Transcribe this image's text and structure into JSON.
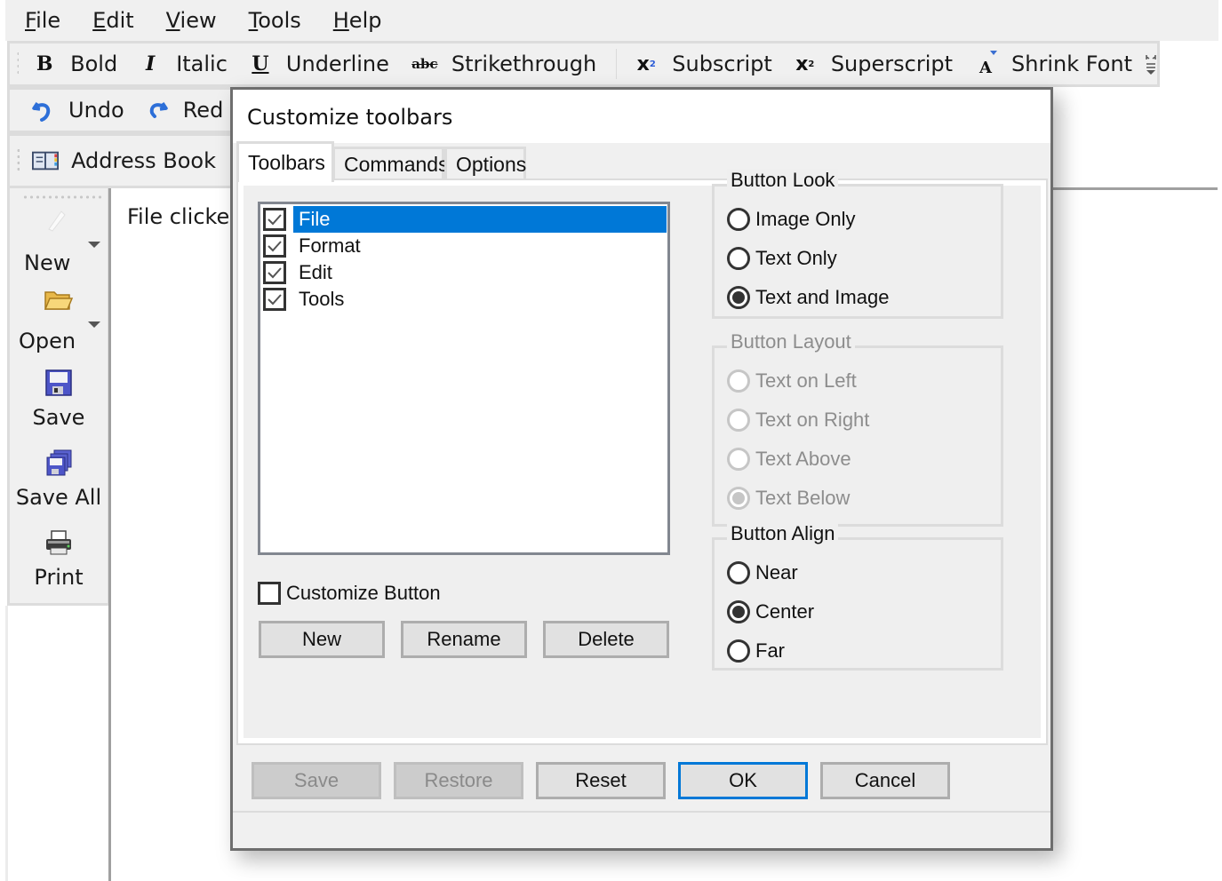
{
  "menubar": {
    "items": [
      {
        "label": "File",
        "mnemonic": "F",
        "rest": "ile"
      },
      {
        "label": "Edit",
        "mnemonic": "E",
        "rest": "dit"
      },
      {
        "label": "View",
        "mnemonic": "V",
        "rest": "iew"
      },
      {
        "label": "Tools",
        "mnemonic": "T",
        "rest": "ools"
      },
      {
        "label": "Help",
        "mnemonic": "H",
        "rest": "elp"
      }
    ]
  },
  "format_toolbar": {
    "buttons": [
      {
        "icon": "bold-icon",
        "glyph": "B",
        "label": "Bold"
      },
      {
        "icon": "italic-icon",
        "glyph": "I",
        "label": "Italic"
      },
      {
        "icon": "underline-icon",
        "glyph": "U",
        "label": "Underline"
      },
      {
        "icon": "strikethrough-icon",
        "glyph": "abc",
        "label": "Strikethrough"
      },
      {
        "icon": "subscript-icon",
        "glyph": "x",
        "label": "Subscript"
      },
      {
        "icon": "superscript-icon",
        "glyph": "x",
        "label": "Superscript"
      },
      {
        "icon": "shrink-font-icon",
        "glyph": "A",
        "label": "Shrink Font"
      }
    ]
  },
  "edit_toolbar": {
    "buttons": [
      {
        "icon": "undo-icon",
        "label": "Undo"
      },
      {
        "icon": "redo-icon",
        "label": "Red"
      }
    ]
  },
  "tools_toolbar": {
    "buttons": [
      {
        "icon": "address-book-icon",
        "label": "Address Book"
      }
    ]
  },
  "file_toolbar": {
    "buttons": [
      {
        "icon": "new-icon",
        "label": "New",
        "dropdown": true
      },
      {
        "icon": "open-folder-icon",
        "label": "Open",
        "dropdown": true
      },
      {
        "icon": "save-icon",
        "label": "Save"
      },
      {
        "icon": "save-all-icon",
        "label": "Save All"
      },
      {
        "icon": "print-icon",
        "label": "Print"
      }
    ]
  },
  "content": {
    "status_text": "File clicked"
  },
  "dialog": {
    "title": "Customize toolbars",
    "tabs": [
      {
        "label": "Toolbars",
        "active": true
      },
      {
        "label": "Commands",
        "active": false
      },
      {
        "label": "Options",
        "active": false
      }
    ],
    "toolbar_list": [
      {
        "label": "File",
        "checked": true,
        "selected": true
      },
      {
        "label": "Format",
        "checked": true,
        "selected": false
      },
      {
        "label": "Edit",
        "checked": true,
        "selected": false
      },
      {
        "label": "Tools",
        "checked": true,
        "selected": false
      }
    ],
    "customize_button": {
      "label": "Customize Button",
      "checked": false
    },
    "list_buttons": {
      "new": "New",
      "rename": "Rename",
      "delete": "Delete"
    },
    "button_look": {
      "title": "Button Look",
      "options": [
        {
          "label": "Image Only",
          "selected": false
        },
        {
          "label": "Text Only",
          "selected": false
        },
        {
          "label": "Text and Image",
          "selected": true
        }
      ]
    },
    "button_layout": {
      "title": "Button Layout",
      "enabled": false,
      "options": [
        {
          "label": "Text on Left",
          "selected": false
        },
        {
          "label": "Text on Right",
          "selected": false
        },
        {
          "label": "Text Above",
          "selected": false
        },
        {
          "label": "Text Below",
          "selected": true
        }
      ]
    },
    "button_align": {
      "title": "Button Align",
      "options": [
        {
          "label": "Near",
          "selected": false
        },
        {
          "label": "Center",
          "selected": true
        },
        {
          "label": "Far",
          "selected": false
        }
      ]
    },
    "footer_buttons": {
      "save": {
        "label": "Save",
        "enabled": false
      },
      "restore": {
        "label": "Restore",
        "enabled": false
      },
      "reset": {
        "label": "Reset",
        "enabled": true
      },
      "ok": {
        "label": "OK",
        "enabled": true,
        "default": true
      },
      "cancel": {
        "label": "Cancel",
        "enabled": true
      }
    },
    "colors": {
      "selection": "#0078d7",
      "default_button_border": "#0078d7"
    }
  }
}
